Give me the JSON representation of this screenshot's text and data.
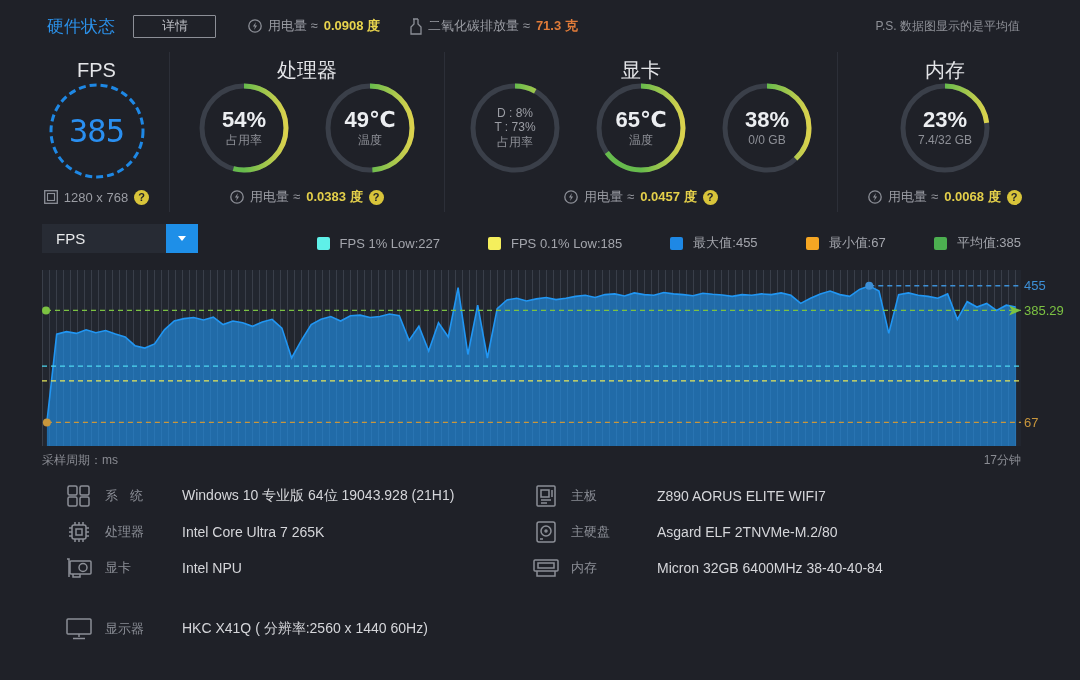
{
  "header": {
    "title": "硬件状态",
    "details_button": "详情",
    "energy": {
      "label": "用电量 ≈",
      "value": "0.0908 度"
    },
    "emission": {
      "label": "二氧化碳排放量 ≈",
      "value": "71.3 克"
    },
    "note": "P.S. 数据图显示的是平均值"
  },
  "monitors": [
    {
      "title": "FPS",
      "gauges": [
        {
          "kind": "fps",
          "value": "385"
        }
      ],
      "footer": {
        "kind": "resolution",
        "text": "1280 x 768",
        "help": "?"
      }
    },
    {
      "title": "处理器",
      "gauges": [
        {
          "kind": "ring",
          "value": "54%",
          "caption": "占用率",
          "level": 0.54
        },
        {
          "kind": "ring",
          "value": "49℃",
          "caption": "温度",
          "level": 0.49
        }
      ],
      "footer": {
        "kind": "power",
        "label": "用电量 ≈",
        "value": "0.0383 度",
        "help": "?"
      }
    },
    {
      "title": "显卡",
      "gauges": [
        {
          "kind": "dual",
          "lines": [
            "D : 8%",
            "T : 73%"
          ],
          "caption": "占用率",
          "level": 0.08
        },
        {
          "kind": "ring",
          "value": "65℃",
          "caption": "温度",
          "level": 0.65
        },
        {
          "kind": "ring",
          "value": "38%",
          "caption": "0/0 GB",
          "level": 0.38
        }
      ],
      "footer": {
        "kind": "power",
        "label": "用电量 ≈",
        "value": "0.0457 度",
        "help": "?"
      }
    },
    {
      "title": "内存",
      "gauges": [
        {
          "kind": "ring",
          "value": "23%",
          "caption": "7.4/32 GB",
          "level": 0.23
        }
      ],
      "footer": {
        "kind": "power",
        "label": "用电量 ≈",
        "value": "0.0068 度",
        "help": "?"
      }
    }
  ],
  "chart_panel": {
    "dropdown": {
      "value": "FPS"
    },
    "legend": [
      {
        "label": "FPS 1% Low:227",
        "color": "#5ff0e8"
      },
      {
        "label": "FPS 0.1% Low:185",
        "color": "#f4ee5c"
      },
      {
        "label": "最大值:455",
        "color": "#1e88e5"
      },
      {
        "label": "最小值:67",
        "color": "#f5a623"
      },
      {
        "label": "平均值:385",
        "color": "#4caf50"
      }
    ],
    "chart_data": {
      "type": "area",
      "ylim": [
        0,
        500
      ],
      "yticks": [
        {
          "value": 67,
          "label": "67"
        },
        {
          "value": 385.29,
          "label": "385.29"
        },
        {
          "value": 455,
          "label": "455"
        }
      ],
      "tick_labels": "y",
      "grid": "x",
      "color": "#2196f3",
      "categories": [
        null,
        null,
        null,
        null,
        null,
        null,
        null,
        null,
        null,
        null,
        null,
        null,
        null,
        null,
        null,
        null,
        null,
        null,
        null,
        null,
        null,
        null,
        null,
        null,
        null,
        null,
        null,
        null,
        null,
        null,
        null,
        null,
        null,
        null,
        null,
        null,
        null,
        null,
        null,
        null,
        null,
        null,
        null,
        null,
        null,
        null,
        null,
        null,
        null,
        null,
        null,
        null,
        null,
        null,
        null,
        null,
        null,
        null,
        null,
        null,
        null,
        null,
        null,
        null,
        null,
        null,
        null,
        null,
        null,
        null,
        null,
        null,
        null,
        null,
        null,
        null,
        null,
        null,
        null,
        null,
        null,
        null,
        null,
        null,
        null,
        null,
        null,
        null,
        null,
        null,
        null,
        null,
        null,
        null,
        null,
        null,
        null,
        null,
        null,
        null
      ],
      "values": [
        67,
        318,
        325,
        320,
        330,
        322,
        328,
        318,
        310,
        285,
        278,
        290,
        330,
        355,
        362,
        365,
        358,
        366,
        345,
        355,
        350,
        340,
        352,
        360,
        335,
        250,
        300,
        345,
        360,
        368,
        355,
        370,
        372,
        365,
        368,
        375,
        370,
        300,
        340,
        270,
        350,
        310,
        450,
        260,
        400,
        250,
        390,
        415,
        420,
        412,
        418,
        422,
        416,
        420,
        425,
        428,
        422,
        430,
        432,
        426,
        435,
        430,
        428,
        436,
        432,
        430,
        427,
        434,
        431,
        429,
        425,
        430,
        428,
        432,
        430,
        435,
        428,
        405,
        420,
        432,
        440,
        430,
        425,
        445,
        455,
        440,
        320,
        430,
        435,
        428,
        425,
        420,
        432,
        360,
        410,
        395,
        405,
        385,
        400,
        395
      ],
      "ref_lines": [
        {
          "axis": "y",
          "value": 455,
          "color": "#3d8fd6",
          "line_style": "dashed"
        },
        {
          "axis": "y",
          "value": 385.29,
          "color": "#7cc242",
          "line_style": "dashed"
        },
        {
          "axis": "y",
          "value": 227,
          "color": "#4fd8f0",
          "line_style": "dashed"
        },
        {
          "axis": "y",
          "value": 185,
          "color": "#e6e65a",
          "line_style": "dashed"
        },
        {
          "axis": "y",
          "value": 67,
          "color": "#c8963c",
          "line_style": "dashed"
        }
      ]
    },
    "sampling_note": "采样周期：ms",
    "duration": "17分钟"
  },
  "system_info": [
    {
      "kind": "os",
      "label": "系 统",
      "value": "Windows 10 专业版 64位 19043.928 (21H1)"
    },
    {
      "kind": "board",
      "label": "主板",
      "value": "Z890 AORUS ELITE WIFI7"
    },
    {
      "kind": "cpu",
      "label": "处理器",
      "value": "Intel Core Ultra 7 265K"
    },
    {
      "kind": "disk",
      "label": "主硬盘",
      "value": "Asgard ELF 2TNVMe-M.2/80"
    },
    {
      "kind": "gpu",
      "label": "显卡",
      "value": "Intel NPU"
    },
    {
      "kind": "memory",
      "label": "内存",
      "value": "Micron 32GB 6400MHz 38-40-40-84"
    },
    {
      "kind": "display",
      "label": "显示器",
      "value": "HKC X41Q ( 分辨率:2560 x 1440 60Hz)"
    }
  ]
}
